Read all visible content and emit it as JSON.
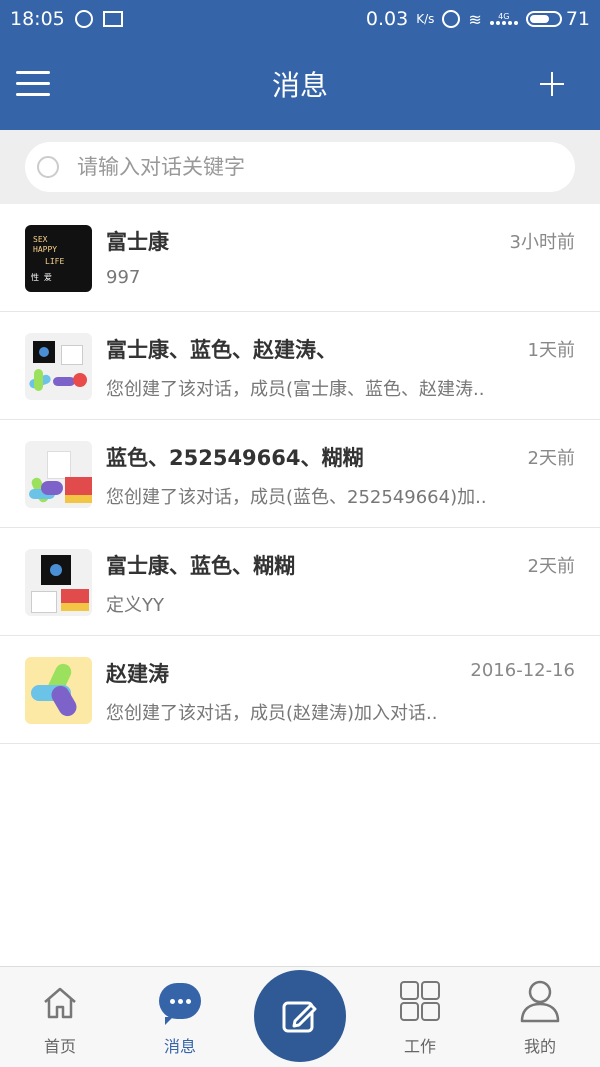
{
  "status_bar": {
    "time": "18:05",
    "speed": "0.03",
    "speed_unit": "K/s",
    "network": "4G",
    "battery": "71"
  },
  "header": {
    "title": "消息",
    "menu_icon": "hamburger-menu-icon",
    "add_icon": "plus-icon"
  },
  "search": {
    "placeholder": "请输入对话关键字",
    "icon": "search-icon"
  },
  "conversations": [
    {
      "name": "富士康",
      "time": "3小时前",
      "preview": "997"
    },
    {
      "name": "富士康、蓝色、赵建涛、",
      "time": "1天前",
      "preview": "您创建了该对话，成员(富士康、蓝色、赵建涛.."
    },
    {
      "name": "蓝色、252549664、糊糊",
      "time": "2天前",
      "preview": "您创建了该对话，成员(蓝色、252549664)加.."
    },
    {
      "name": "富士康、蓝色、糊糊",
      "time": "2天前",
      "preview": "定义YY"
    },
    {
      "name": "赵建涛",
      "time": "2016-12-16",
      "preview": "您创建了该对话，成员(赵建涛)加入对话.."
    }
  ],
  "avatar_text": {
    "line1": "SEX",
    "line2": "HAPPY",
    "line3": "LIFE",
    "line4": "性  爱"
  },
  "bottom_nav": {
    "home": "首页",
    "messages": "消息",
    "compose_icon": "edit-icon",
    "work": "工作",
    "mine": "我的"
  },
  "colors": {
    "primary": "#3565a8",
    "compose_button": "#2f5a95",
    "text": "#333333",
    "muted": "#888888"
  }
}
